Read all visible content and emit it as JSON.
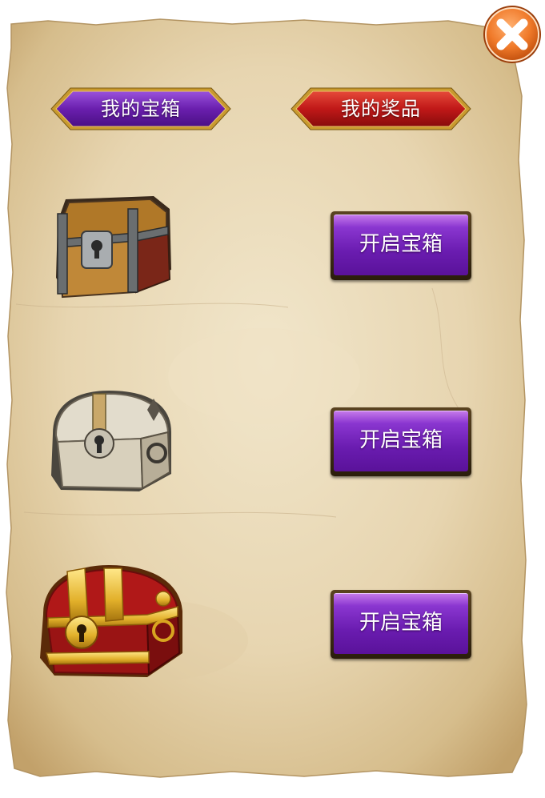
{
  "tabs": {
    "my_chests_label": "我的宝箱",
    "my_prizes_label": "我的奖品"
  },
  "chests": [
    {
      "name": "wooden-chest",
      "button_label": "开启宝箱"
    },
    {
      "name": "silver-chest",
      "button_label": "开启宝箱"
    },
    {
      "name": "golden-chest",
      "button_label": "开启宝箱"
    }
  ],
  "colors": {
    "parchment": "#e8d9b8",
    "tab_purple": "#6a1fae",
    "tab_red": "#c01818",
    "button_purple": "#7a2cc4",
    "close_orange": "#f07a2a"
  }
}
